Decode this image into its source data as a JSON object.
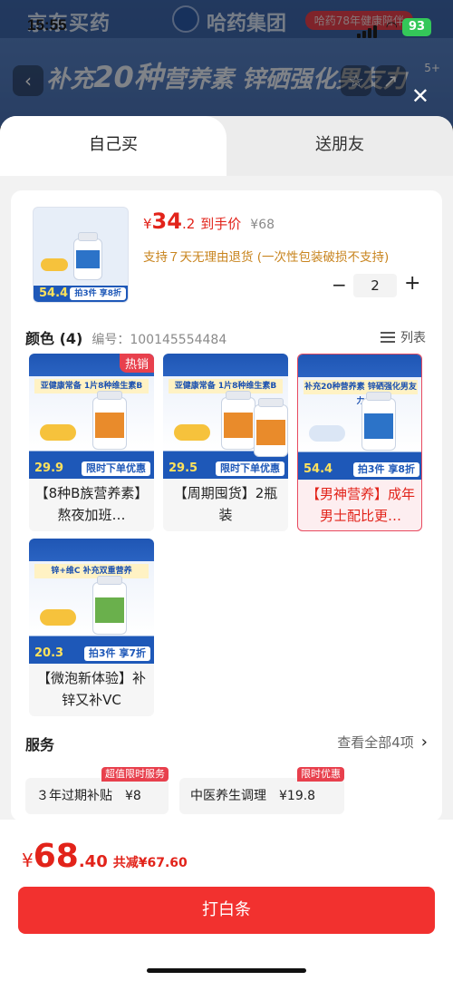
{
  "status_bar": {
    "time": "15:55",
    "battery": "93"
  },
  "background": {
    "brand_left": "京东买药",
    "brand_right": "哈药集团",
    "promo_pill": "哈药78年健康陪伴",
    "banner_prefix": "补充",
    "banner_highlight": "20种",
    "banner_suffix": "营养素 锌硒强化男友力",
    "badge": "5+"
  },
  "sheet": {
    "tabs": [
      {
        "label": "自己买"
      },
      {
        "label": "送朋友"
      }
    ],
    "product": {
      "price_symbol": "¥",
      "price_int": "34",
      "price_dec": ".2",
      "price_label": "到手价",
      "original_price": "¥68",
      "refund_note": "支持７天无理由退货 (一次性包装破损不支持)",
      "quantity": "2",
      "thumb": {
        "bar_price": "54.4",
        "bar_deal": "拍3件 享8折"
      }
    },
    "color": {
      "title": "颜色 (4)",
      "code": "编号：100145554484",
      "view_label": "列表"
    },
    "variants": [
      {
        "name": "【8种B族营养素】熬夜加班…",
        "hot": "热销",
        "top_tag": "亚健康常备 1片8种维生素B",
        "bar_price": "29.9",
        "bar_deal": "限时下单优惠"
      },
      {
        "name": "【周期囤货】2瓶装",
        "top_tag": "亚健康常备 1片8种维生素B",
        "bar_price": "29.5",
        "bar_deal": "限时下单优惠"
      },
      {
        "name": "【男神营养】成年男士配比更…",
        "top_tag": "补充20种营养素 锌硒强化男友力",
        "bar_price": "54.4",
        "bar_deal": "拍3件 享8折"
      },
      {
        "name": "【微泡新体验】补锌又补VC",
        "top_tag": "锌+维C 补充双重营养",
        "bar_price": "20.3",
        "bar_deal": "拍3件 享7折"
      }
    ],
    "services": {
      "title": "服务",
      "more": "查看全部4项",
      "items": [
        {
          "name": "３年过期补贴",
          "price": "¥8",
          "badge": "超值限时服务"
        },
        {
          "name": "中医养生调理",
          "price": "¥19.8",
          "badge": "限时优惠"
        }
      ]
    }
  },
  "footer": {
    "total_symbol": "¥",
    "total_int": "68",
    "total_dec": ".40",
    "savings": "共减¥67.60",
    "pay_button": "打白条"
  },
  "colors": {
    "accent": "#f2312f",
    "price": "#e2231a",
    "refund": "#c8841e"
  }
}
